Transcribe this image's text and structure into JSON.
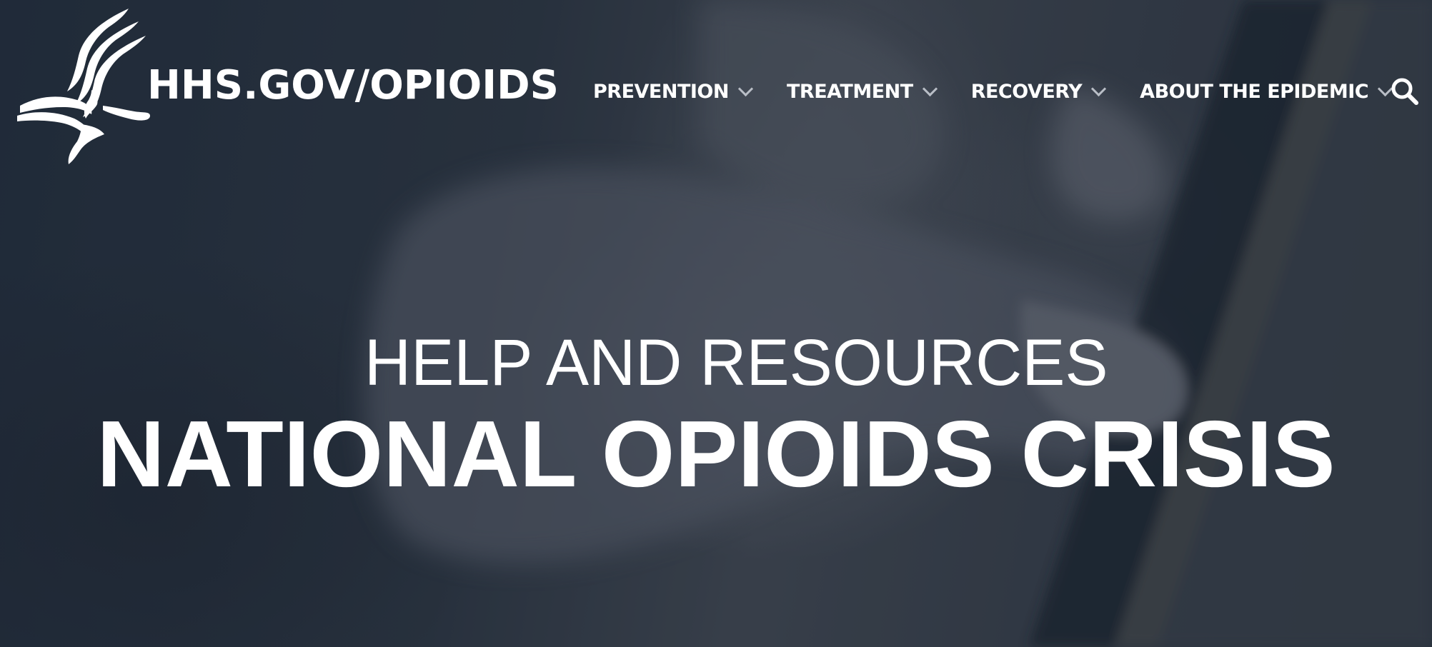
{
  "header": {
    "site_name": "HHS.GOV/OPIOIDS",
    "logo_icon": "hhs-eagle-logo"
  },
  "nav": {
    "items": [
      {
        "label": "PREVENTION",
        "icon": "chevron-down-icon"
      },
      {
        "label": "TREATMENT",
        "icon": "chevron-down-icon"
      },
      {
        "label": "RECOVERY",
        "icon": "chevron-down-icon"
      },
      {
        "label": "ABOUT THE EPIDEMIC",
        "icon": "chevron-down-icon"
      }
    ],
    "search_icon": "search-icon"
  },
  "hero": {
    "kicker": "HELP AND RESOURCES",
    "title": "NATIONAL OPIOIDS CRISIS"
  },
  "colors": {
    "text": "#ffffff",
    "chevron": "#b9bec6",
    "background": "#2f3946"
  }
}
